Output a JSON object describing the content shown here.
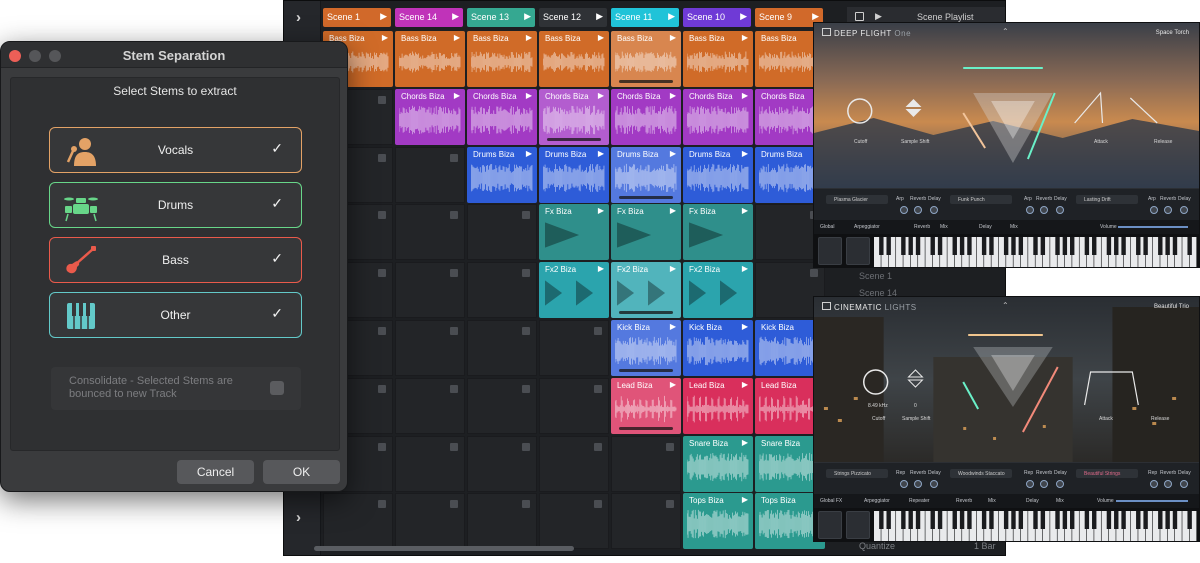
{
  "daw": {
    "scenes": [
      {
        "label": "Scene 1",
        "color": "#d1692a"
      },
      {
        "label": "Scene 14",
        "color": "#c033b9"
      },
      {
        "label": "Scene 13",
        "color": "#35a891"
      },
      {
        "label": "Scene 12",
        "color": "#2f3236"
      },
      {
        "label": "Scene 11",
        "color": "#20c3d8"
      },
      {
        "label": "Scene 10",
        "color": "#6f3ad6"
      },
      {
        "label": "Scene 9",
        "color": "#d1692a"
      }
    ],
    "playlist": {
      "title": "Scene Playlist",
      "items": [
        "Scene 1",
        "Scene 14"
      ]
    },
    "quantize": {
      "label": "Quantize",
      "value": "1 Bar"
    },
    "tracks": [
      {
        "name": "Bass Biza",
        "color": "#d06b28",
        "start": 0,
        "end": 6,
        "selected": 4,
        "type": "mid"
      },
      {
        "name": "Chords Biza",
        "color": "#a23ac4",
        "start": 1,
        "end": 6,
        "selected": 3,
        "type": "dense"
      },
      {
        "name": "Drums Biza",
        "color": "#2e5cd8",
        "start": 2,
        "end": 6,
        "selected": 4,
        "type": "dense"
      },
      {
        "name": "Fx Biza",
        "color": "#2f8f8b",
        "start": 3,
        "end": 5,
        "selected": -1,
        "type": "ramp"
      },
      {
        "name": "Fx2 Biza",
        "color": "#2ba4ad",
        "start": 3,
        "end": 5,
        "selected": 4,
        "type": "ramp2"
      },
      {
        "name": "Kick Biza",
        "color": "#2e5cd8",
        "start": 4,
        "end": 6,
        "selected": 4,
        "type": "dense"
      },
      {
        "name": "Lead Biza",
        "color": "#d92f5c",
        "start": 4,
        "end": 6,
        "selected": 4,
        "type": "sparse"
      },
      {
        "name": "Snare Biza",
        "color": "#2b9a8f",
        "start": 5,
        "end": 6,
        "selected": -1,
        "type": "dense"
      },
      {
        "name": "Tops Biza",
        "color": "#2b9a8f",
        "start": 5,
        "end": 6,
        "selected": -1,
        "type": "dense"
      }
    ]
  },
  "dialog": {
    "title": "Stem Separation",
    "subtitle": "Select Stems to extract",
    "stems": [
      {
        "label": "Vocals",
        "icon": "microphone-singer-icon",
        "color": "#e3a266",
        "checked": true
      },
      {
        "label": "Drums",
        "icon": "drum-kit-icon",
        "color": "#68d689",
        "checked": true
      },
      {
        "label": "Bass",
        "icon": "bass-guitar-icon",
        "color": "#ea5a4b",
        "checked": true
      },
      {
        "label": "Other",
        "icon": "piano-keys-icon",
        "color": "#63c9c9",
        "checked": true
      }
    ],
    "checkmark": "✓",
    "consolidate": "Consolidate - Selected Stems are bounced to new Track",
    "cancel": "Cancel",
    "ok": "OK"
  },
  "plugin1": {
    "title": "DEEP FLIGHT",
    "title_thin": "One",
    "preset": "Space Torch",
    "labels": {
      "cutoff": "Cutoff",
      "sample_shift": "Sample Shift",
      "attack": "Attack",
      "release": "Release"
    },
    "slots": [
      "Plasma Glacier",
      "Funk Punch",
      "Lasting Drift"
    ],
    "slot_tags": [
      "Arp",
      "Reverb",
      "Delay"
    ],
    "controls": [
      "Global",
      "Arpeggiator",
      "Reverb",
      "Mix",
      "Delay",
      "Mix",
      "Volume"
    ]
  },
  "plugin2": {
    "title": "CINEMATIC",
    "title_thin": "LIGHTS",
    "preset": "Beautiful Trio",
    "labels": {
      "cutoff": "Cutoff",
      "cutoff_value": "8.49 kHz",
      "sample_shift": "Sample Shift",
      "sample_value": "0",
      "attack": "Attack",
      "release": "Release"
    },
    "slots": [
      "Strings Pizzicato",
      "Woodwinds Staccato",
      "Beautiful Strings"
    ],
    "slot_tags": [
      "Rep",
      "Reverb",
      "Delay"
    ],
    "controls": [
      "Global FX",
      "Arpeggiator",
      "Repeater",
      "Reverb",
      "Mix",
      "Delay",
      "Mix",
      "Volume"
    ]
  }
}
